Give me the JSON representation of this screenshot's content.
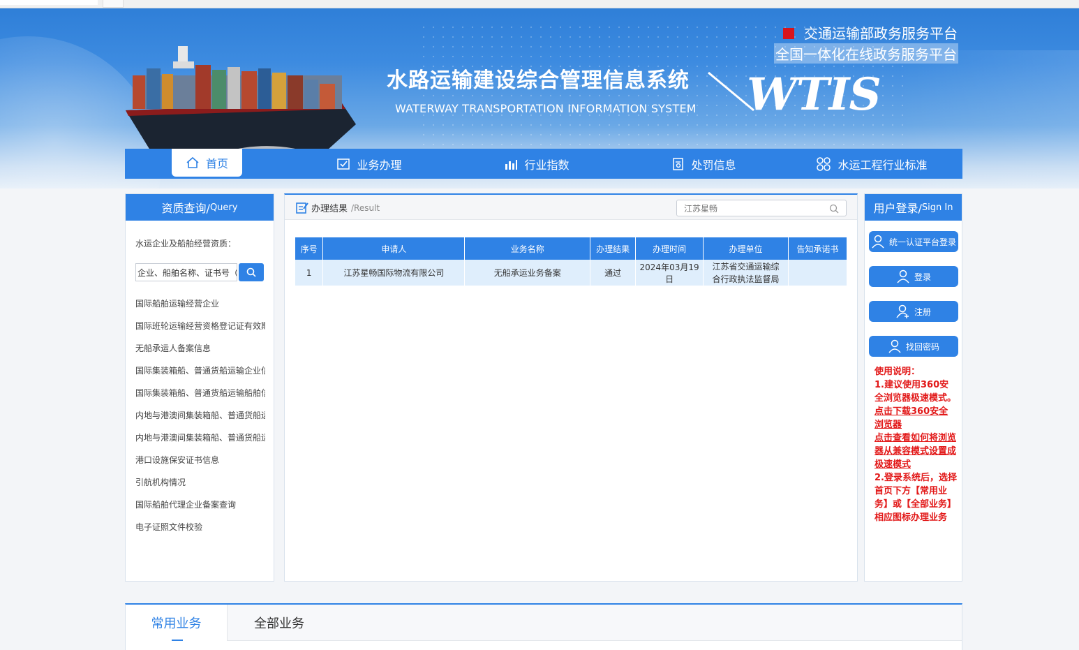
{
  "header": {
    "gov_line1": "交通运输部政务服务平台",
    "gov_line2": "全国一体化在线政务服务平台",
    "title_cn": "水路运输建设综合管理信息系统",
    "title_en": "WATERWAY TRANSPORTATION INFORMATION SYSTEM",
    "logo": "WTIS"
  },
  "nav": [
    {
      "label": "首页",
      "icon": "home-icon"
    },
    {
      "label": "业务办理",
      "icon": "checklist-icon"
    },
    {
      "label": "行业指数",
      "icon": "bar-chart-icon"
    },
    {
      "label": "处罚信息",
      "icon": "document-search-icon"
    },
    {
      "label": "水运工程行业标准",
      "icon": "grid-shape-icon"
    }
  ],
  "query": {
    "title": "资质查询/",
    "title_en": "Query",
    "caption": "水运企业及船舶经营资质：",
    "search_value": "企业、船舶名称、证书号（",
    "items": [
      "国际船舶运输经营企业",
      "国际班轮运输经营资格登记证有效期",
      "无船承运人备案信息",
      "国际集装箱船、普通货船运输企业信息",
      "国际集装箱船、普通货船运输船舶信息",
      "内地与港澳间集装箱船、普通货船运输",
      "内地与港澳间集装箱船、普通货船运输",
      "港口设施保安证书信息",
      "引航机构情况",
      "国际船舶代理企业备案查询",
      "电子证照文件校验"
    ]
  },
  "result": {
    "title": "办理结果",
    "title_en": "/Result",
    "search_value": "江苏星畅",
    "columns": [
      "序号",
      "申请人",
      "业务名称",
      "办理结果",
      "办理时间",
      "办理单位",
      "告知承诺书"
    ],
    "rows": [
      {
        "no": "1",
        "applicant": "江苏星畅国际物流有限公司",
        "business": "无船承运业务备案",
        "result": "通过",
        "time": "2024年03月19日",
        "unit_line1": "江苏省交通运输综",
        "unit_line2": "合行政执法监督局",
        "letter": ""
      }
    ]
  },
  "login": {
    "title": "用户登录/",
    "title_en": "Sign In",
    "btn_unified": "统一认证平台登录",
    "btn_login": "登录",
    "btn_register": "注册",
    "btn_recover": "找回密码",
    "notes_title": "使用说明：",
    "note1": "1.建议使用360安全浏览器极速模式。",
    "link_download": "点击下载360安全浏览器",
    "link_howto": "点击查看如何将浏览器从兼容模式设置成极速模式",
    "note2": "2.登录系统后，选择首页下方【常用业务】或【全部业务】相应图标办理业务"
  },
  "bottom_tabs": [
    "常用业务",
    "全部业务"
  ],
  "colors": {
    "primary": "#2f82e5",
    "notes": "#e21818",
    "row_bg": "#dfeefc"
  }
}
